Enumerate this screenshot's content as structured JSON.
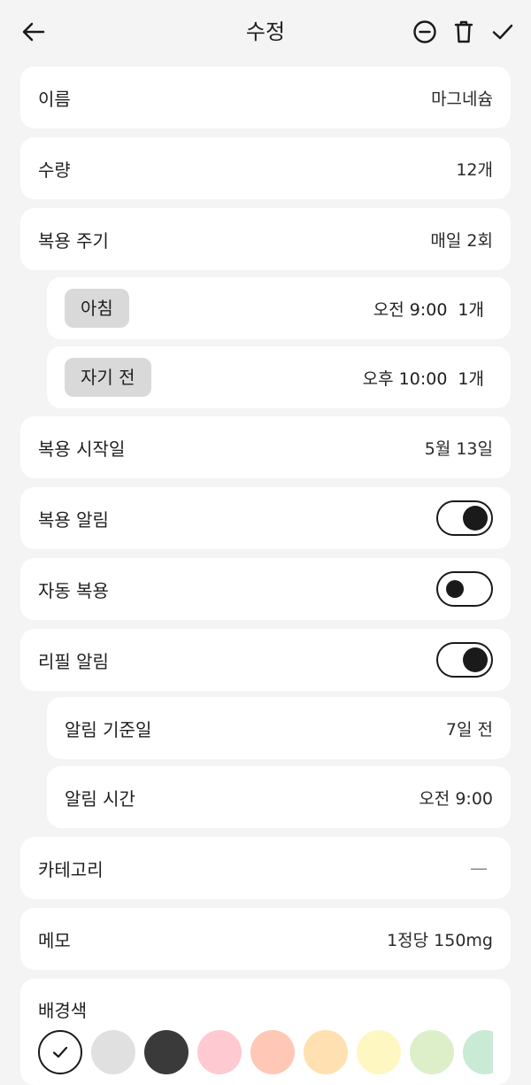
{
  "header": {
    "title": "수정"
  },
  "fields": {
    "name": {
      "label": "이름",
      "value": "마그네슘"
    },
    "quantity": {
      "label": "수량",
      "value": "12개"
    },
    "cycle": {
      "label": "복용 주기",
      "value": "매일 2회"
    },
    "schedule": [
      {
        "label": "아침",
        "time": "오전 9:00",
        "dose": "1개"
      },
      {
        "label": "자기 전",
        "time": "오후 10:00",
        "dose": "1개"
      }
    ],
    "start_date": {
      "label": "복용 시작일",
      "value": "5월 13일"
    },
    "dose_alarm": {
      "label": "복용 알림",
      "on": true
    },
    "auto_dose": {
      "label": "자동 복용",
      "on": false
    },
    "refill_alarm": {
      "label": "리필 알림",
      "on": true
    },
    "refill_base_day": {
      "label": "알림 기준일",
      "value": "7일 전"
    },
    "refill_time": {
      "label": "알림 시간",
      "value": "오전 9:00"
    },
    "category": {
      "label": "카테고리",
      "value": "—"
    },
    "memo": {
      "label": "메모",
      "value": "1정당 150mg"
    },
    "background": {
      "label": "배경색",
      "colors": [
        "#ffffff",
        "#e0e0e0",
        "#3a3a3a",
        "#ffc9d2",
        "#ffc7b6",
        "#ffe0b0",
        "#fff7c2",
        "#dcefc9",
        "#c9ead4"
      ],
      "selected_index": 0
    }
  },
  "icons": {
    "back": "arrow-left-icon",
    "pause": "minus-circle-icon",
    "delete": "trash-icon",
    "confirm": "check-icon"
  }
}
